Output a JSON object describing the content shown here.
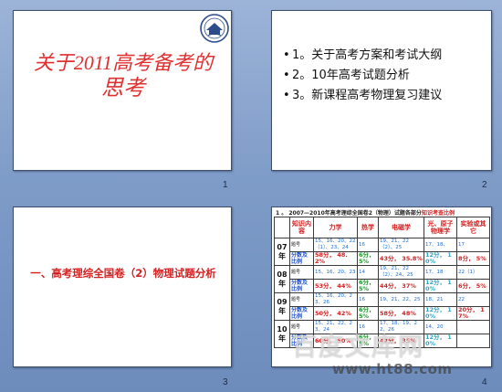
{
  "slides": [
    {
      "number": "1",
      "title_line1": "关于2011高考备考的",
      "title_line2": "思考",
      "logo_icon": "university-seal-icon"
    },
    {
      "number": "2",
      "items": [
        "1。关于高考方案和考试大纲",
        "2。10年高考试题分析",
        "3。新课程高考物理复习建议"
      ]
    },
    {
      "number": "3",
      "title": "一、高考理综全国卷（2）物理试题分析"
    },
    {
      "number": "4",
      "heading_prefix": "1 。 2007—2010年高考理综全国卷2（物理）试题各部分",
      "heading_highlight": "知识考查比例",
      "table": {
        "headers": [
          "知识内容",
          "力学",
          "热学",
          "电磁学",
          "光、原子物理学",
          "实验或其它"
        ],
        "rows": [
          {
            "year": "07年",
            "label1": "题号",
            "q": [
              "15、16、20、22（1）、23、24",
              "16",
              "19、21、22（2）、25",
              "17、18、",
              "17"
            ],
            "label2": "分数及比例",
            "s": [
              "58分， 48.2%",
              "6分， 5%",
              "43分， 35.8%",
              "12分， 10%",
              "8分， 5%"
            ]
          },
          {
            "year": "08年",
            "label1": "题号",
            "q": [
              "15、16、20、23",
              "14",
              "19、21、22（2）、24、25",
              "17、18",
              "22（1）"
            ],
            "label2": "分数及比例",
            "s": [
              "53分， 44%",
              "6分， 5%",
              "44分， 37%",
              "12分， 10%",
              "6分， 5%"
            ]
          },
          {
            "year": "09年",
            "label1": "题号",
            "q": [
              "15、16、20、23、26",
              "16",
              "19、21、22、25",
              "18、21",
              "22"
            ],
            "label2": "分数及比例",
            "s": [
              "50分， 42%",
              "6分， 5%",
              "58分， 48%",
              "12分， 10%",
              "20分， 17%"
            ]
          },
          {
            "year": "10年",
            "label1": "题号",
            "q": [
              "15、21、22、23、24",
              "16",
              "17、18、19、22、26",
              "14、20",
              ""
            ],
            "label2": "分数及比例",
            "s": [
              "60分， 50%",
              "6分， 5%",
              "42分， 35%",
              "12分， 10%",
              ""
            ]
          }
        ]
      }
    }
  ],
  "watermark": {
    "text": "百度文库网",
    "url": "www.ht88.com"
  }
}
